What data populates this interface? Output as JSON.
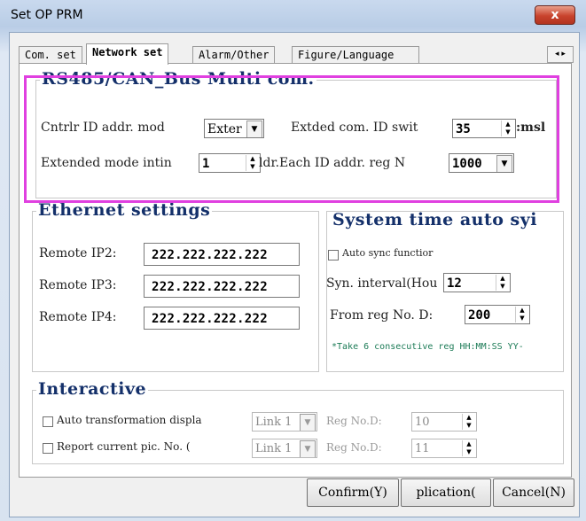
{
  "window": {
    "title": "Set OP PRM",
    "close_glyph": "x"
  },
  "tabs": [
    "Com. set",
    "Network set",
    "Alarm/Other",
    "Figure/Language"
  ],
  "tab_scroll": "◂ ▸",
  "rs485": {
    "title": "RS485/CAN_Bus Multi com.",
    "ctrl_id_label": "Cntrlr ID addr. mod",
    "ctrl_id_value": "Exter",
    "ext_id_label": "Extded com. ID swit",
    "ext_id_value": "35",
    "ext_id_suffix": ":msl",
    "ext_mode_label": "Extended mode intin",
    "ext_mode_value": "1",
    "each_id_label": "ldr.Each ID addr. reg N",
    "each_id_value": "1000"
  },
  "ethernet": {
    "title": "Ethernet settings",
    "rows": [
      {
        "label": "Remote IP2:",
        "value": "222.222.222.222"
      },
      {
        "label": "Remote IP3:",
        "value": "222.222.222.222"
      },
      {
        "label": "Remote IP4:",
        "value": "222.222.222.222"
      }
    ]
  },
  "systime": {
    "title": "System time auto syi",
    "auto_sync_label": "Auto sync functior",
    "interval_label": "Syn. interval(Hou",
    "interval_value": "12",
    "from_reg_label": "From reg No. D:",
    "from_reg_value": "200",
    "note": "*Take 6 consecutive reg HH:MM:SS YY-"
  },
  "interactive": {
    "title": "Interactive",
    "rows": [
      {
        "check_label": "Auto transformation displa",
        "link": "Link 1",
        "reg_label": "Reg No.D:",
        "reg_value": "10"
      },
      {
        "check_label": "Report current pic. No.  (",
        "link": "Link 1",
        "reg_label": "Reg No.D:",
        "reg_value": "11"
      }
    ]
  },
  "buttons": {
    "confirm": "Confirm(Y)",
    "application": "plication(",
    "cancel": "Cancel(N)"
  }
}
